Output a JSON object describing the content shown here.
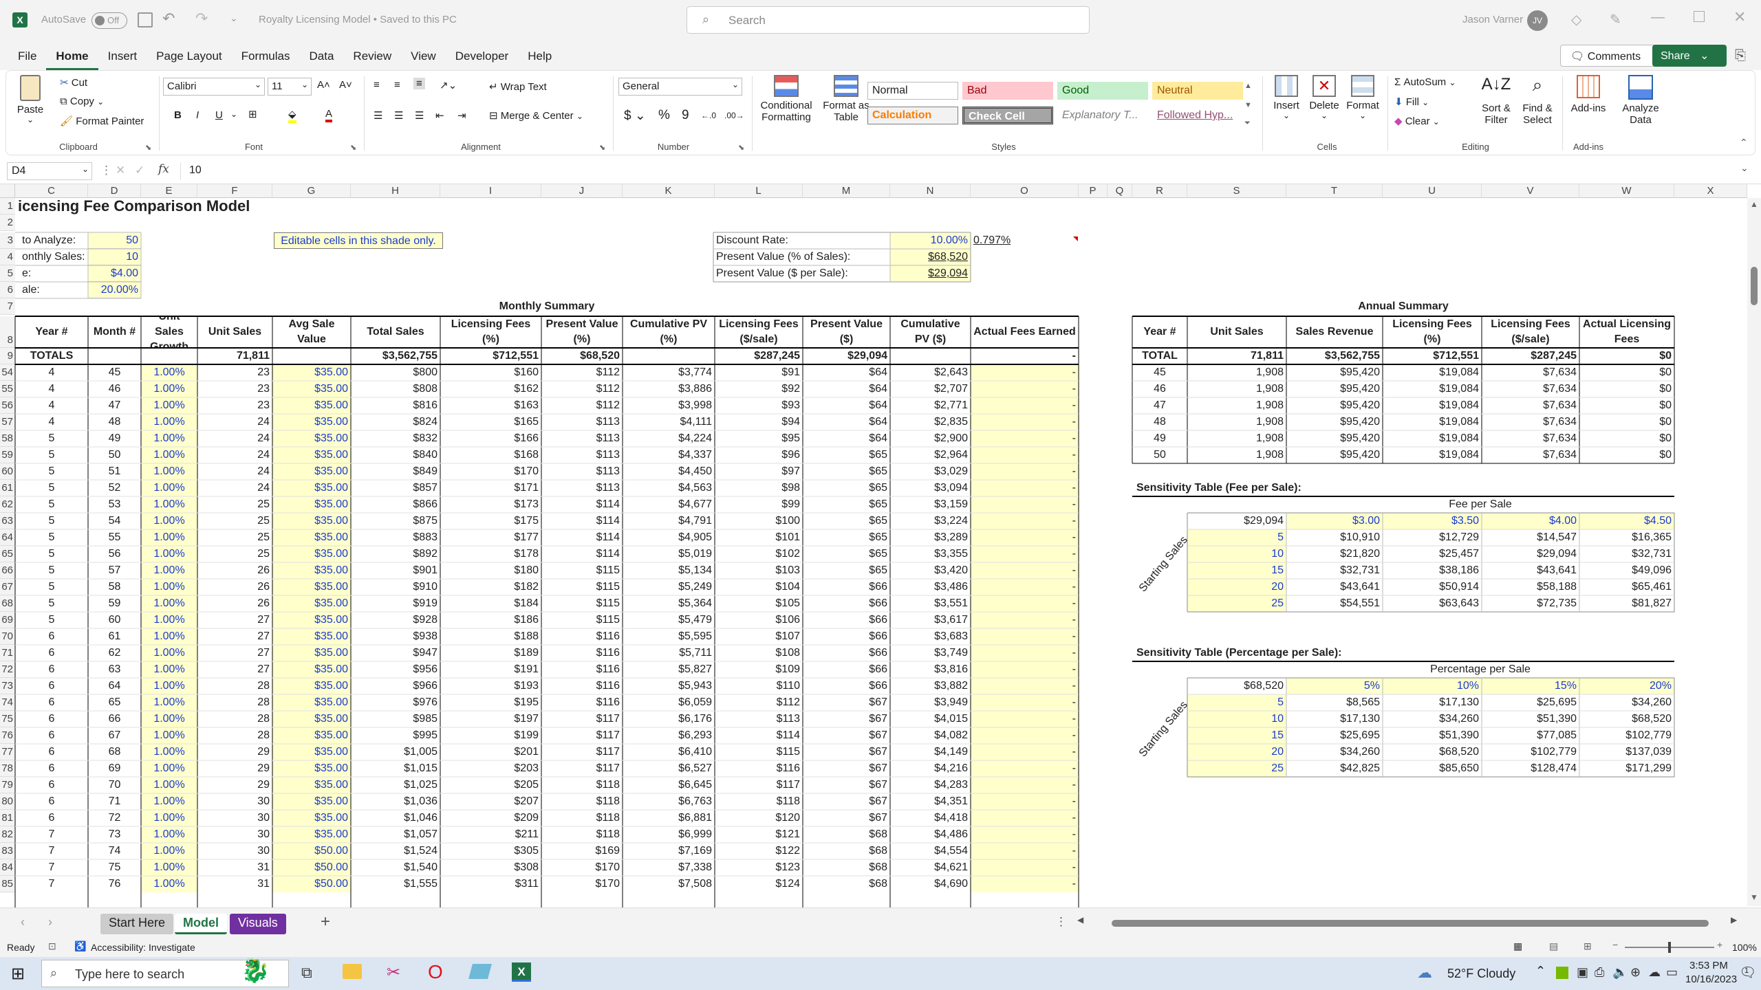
{
  "titlebar": {
    "autosave_label": "AutoSave",
    "autosave_state": "Off",
    "doc_title": "Royalty Licensing Model • Saved to this PC",
    "search_placeholder": "Search",
    "user_name": "Jason Varner",
    "user_initials": "JV"
  },
  "menu": [
    "File",
    "Home",
    "Insert",
    "Page Layout",
    "Formulas",
    "Data",
    "Review",
    "View",
    "Developer",
    "Help"
  ],
  "menu_active": "Home",
  "comments_label": "Comments",
  "share_label": "Share",
  "ribbon": {
    "clipboard": {
      "paste": "Paste",
      "cut": "Cut",
      "copy": "Copy",
      "format_painter": "Format Painter",
      "label": "Clipboard"
    },
    "font": {
      "name": "Calibri",
      "size": "11",
      "label": "Font"
    },
    "alignment": {
      "wrap": "Wrap Text",
      "merge": "Merge & Center",
      "label": "Alignment"
    },
    "number": {
      "format": "General",
      "label": "Number"
    },
    "styles": {
      "cond_fmt": "Conditional Formatting",
      "fmt_table": "Format as Table",
      "label": "Styles",
      "items": [
        "Normal",
        "Bad",
        "Good",
        "Neutral",
        "Calculation",
        "Check Cell",
        "Explanatory T...",
        "Followed Hyp..."
      ]
    },
    "cells": {
      "insert": "Insert",
      "delete": "Delete",
      "format": "Format",
      "label": "Cells"
    },
    "editing": {
      "autosum": "AutoSum",
      "fill": "Fill",
      "clear": "Clear",
      "sort": "Sort & Filter",
      "find": "Find & Select",
      "label": "Editing"
    },
    "addins": {
      "addins": "Add-ins",
      "analyze": "Analyze Data",
      "label": "Add-ins"
    }
  },
  "formula": {
    "namebox": "D4",
    "value": "10"
  },
  "columns": [
    "C",
    "D",
    "E",
    "F",
    "G",
    "H",
    "I",
    "J",
    "K",
    "L",
    "M",
    "N",
    "O",
    "P",
    "Q",
    "R",
    "S",
    "T",
    "U",
    "V",
    "W",
    "X"
  ],
  "rows_top": [
    "1",
    "2",
    "3",
    "4",
    "5",
    "6",
    "7",
    "8",
    "9"
  ],
  "sheet": {
    "title": "icensing Fee Comparison Model",
    "inputs": [
      {
        "label": " to Analyze:",
        "value": "50"
      },
      {
        "label": "onthly Sales:",
        "value": "10"
      },
      {
        "label": "e:",
        "value": "$4.00"
      },
      {
        "label": "ale:",
        "value": "20.00%"
      }
    ],
    "editable_note": "Editable cells in this shade only.",
    "discount": {
      "rows": [
        {
          "label": "Discount Rate:",
          "value": "10.00%",
          "extra": "0.797%"
        },
        {
          "label": "Present Value (% of Sales):",
          "value": "$68,520",
          "extra": ""
        },
        {
          "label": "Present Value ($ per Sale):",
          "value": "$29,094",
          "extra": ""
        }
      ]
    },
    "monthly_title": "Monthly Summary",
    "monthly_headers": [
      "Year #",
      "Month #",
      "Unit Sales Growth",
      "Unit Sales",
      "Avg Sale Value",
      "Total Sales",
      "Licensing Fees (%)",
      "Present Value (%)",
      "Cumulative PV (%)",
      "Licensing Fees ($/sale)",
      "Present Value ($)",
      "Cumulative PV ($)",
      "Actual Fees Earned"
    ],
    "monthly_totals": [
      "TOTALS",
      "",
      "",
      "71,811",
      "",
      "$3,562,755",
      "$712,551",
      "$68,520",
      "",
      "$287,245",
      "$29,094",
      "",
      "-"
    ],
    "monthly_rows": [
      [
        "54",
        "4",
        "45",
        "1.00%",
        "23",
        "$35.00",
        "$800",
        "$160",
        "$112",
        "$3,774",
        "$91",
        "$64",
        "$2,643",
        "-"
      ],
      [
        "55",
        "4",
        "46",
        "1.00%",
        "23",
        "$35.00",
        "$808",
        "$162",
        "$112",
        "$3,886",
        "$92",
        "$64",
        "$2,707",
        "-"
      ],
      [
        "56",
        "4",
        "47",
        "1.00%",
        "23",
        "$35.00",
        "$816",
        "$163",
        "$112",
        "$3,998",
        "$93",
        "$64",
        "$2,771",
        "-"
      ],
      [
        "57",
        "4",
        "48",
        "1.00%",
        "24",
        "$35.00",
        "$824",
        "$165",
        "$113",
        "$4,111",
        "$94",
        "$64",
        "$2,835",
        "-"
      ],
      [
        "58",
        "5",
        "49",
        "1.00%",
        "24",
        "$35.00",
        "$832",
        "$166",
        "$113",
        "$4,224",
        "$95",
        "$64",
        "$2,900",
        "-"
      ],
      [
        "59",
        "5",
        "50",
        "1.00%",
        "24",
        "$35.00",
        "$840",
        "$168",
        "$113",
        "$4,337",
        "$96",
        "$65",
        "$2,964",
        "-"
      ],
      [
        "60",
        "5",
        "51",
        "1.00%",
        "24",
        "$35.00",
        "$849",
        "$170",
        "$113",
        "$4,450",
        "$97",
        "$65",
        "$3,029",
        "-"
      ],
      [
        "61",
        "5",
        "52",
        "1.00%",
        "24",
        "$35.00",
        "$857",
        "$171",
        "$113",
        "$4,563",
        "$98",
        "$65",
        "$3,094",
        "-"
      ],
      [
        "62",
        "5",
        "53",
        "1.00%",
        "25",
        "$35.00",
        "$866",
        "$173",
        "$114",
        "$4,677",
        "$99",
        "$65",
        "$3,159",
        "-"
      ],
      [
        "63",
        "5",
        "54",
        "1.00%",
        "25",
        "$35.00",
        "$875",
        "$175",
        "$114",
        "$4,791",
        "$100",
        "$65",
        "$3,224",
        "-"
      ],
      [
        "64",
        "5",
        "55",
        "1.00%",
        "25",
        "$35.00",
        "$883",
        "$177",
        "$114",
        "$4,905",
        "$101",
        "$65",
        "$3,289",
        "-"
      ],
      [
        "65",
        "5",
        "56",
        "1.00%",
        "25",
        "$35.00",
        "$892",
        "$178",
        "$114",
        "$5,019",
        "$102",
        "$65",
        "$3,355",
        "-"
      ],
      [
        "66",
        "5",
        "57",
        "1.00%",
        "26",
        "$35.00",
        "$901",
        "$180",
        "$115",
        "$5,134",
        "$103",
        "$65",
        "$3,420",
        "-"
      ],
      [
        "67",
        "5",
        "58",
        "1.00%",
        "26",
        "$35.00",
        "$910",
        "$182",
        "$115",
        "$5,249",
        "$104",
        "$66",
        "$3,486",
        "-"
      ],
      [
        "68",
        "5",
        "59",
        "1.00%",
        "26",
        "$35.00",
        "$919",
        "$184",
        "$115",
        "$5,364",
        "$105",
        "$66",
        "$3,551",
        "-"
      ],
      [
        "69",
        "5",
        "60",
        "1.00%",
        "27",
        "$35.00",
        "$928",
        "$186",
        "$115",
        "$5,479",
        "$106",
        "$66",
        "$3,617",
        "-"
      ],
      [
        "70",
        "6",
        "61",
        "1.00%",
        "27",
        "$35.00",
        "$938",
        "$188",
        "$116",
        "$5,595",
        "$107",
        "$66",
        "$3,683",
        "-"
      ],
      [
        "71",
        "6",
        "62",
        "1.00%",
        "27",
        "$35.00",
        "$947",
        "$189",
        "$116",
        "$5,711",
        "$108",
        "$66",
        "$3,749",
        "-"
      ],
      [
        "72",
        "6",
        "63",
        "1.00%",
        "27",
        "$35.00",
        "$956",
        "$191",
        "$116",
        "$5,827",
        "$109",
        "$66",
        "$3,816",
        "-"
      ],
      [
        "73",
        "6",
        "64",
        "1.00%",
        "28",
        "$35.00",
        "$966",
        "$193",
        "$116",
        "$5,943",
        "$110",
        "$66",
        "$3,882",
        "-"
      ],
      [
        "74",
        "6",
        "65",
        "1.00%",
        "28",
        "$35.00",
        "$976",
        "$195",
        "$116",
        "$6,059",
        "$112",
        "$67",
        "$3,949",
        "-"
      ],
      [
        "75",
        "6",
        "66",
        "1.00%",
        "28",
        "$35.00",
        "$985",
        "$197",
        "$117",
        "$6,176",
        "$113",
        "$67",
        "$4,015",
        "-"
      ],
      [
        "76",
        "6",
        "67",
        "1.00%",
        "28",
        "$35.00",
        "$995",
        "$199",
        "$117",
        "$6,293",
        "$114",
        "$67",
        "$4,082",
        "-"
      ],
      [
        "77",
        "6",
        "68",
        "1.00%",
        "29",
        "$35.00",
        "$1,005",
        "$201",
        "$117",
        "$6,410",
        "$115",
        "$67",
        "$4,149",
        "-"
      ],
      [
        "78",
        "6",
        "69",
        "1.00%",
        "29",
        "$35.00",
        "$1,015",
        "$203",
        "$117",
        "$6,527",
        "$116",
        "$67",
        "$4,216",
        "-"
      ],
      [
        "79",
        "6",
        "70",
        "1.00%",
        "29",
        "$35.00",
        "$1,025",
        "$205",
        "$118",
        "$6,645",
        "$117",
        "$67",
        "$4,283",
        "-"
      ],
      [
        "80",
        "6",
        "71",
        "1.00%",
        "30",
        "$35.00",
        "$1,036",
        "$207",
        "$118",
        "$6,763",
        "$118",
        "$67",
        "$4,351",
        "-"
      ],
      [
        "81",
        "6",
        "72",
        "1.00%",
        "30",
        "$35.00",
        "$1,046",
        "$209",
        "$118",
        "$6,881",
        "$120",
        "$67",
        "$4,418",
        "-"
      ],
      [
        "82",
        "7",
        "73",
        "1.00%",
        "30",
        "$35.00",
        "$1,057",
        "$211",
        "$118",
        "$6,999",
        "$121",
        "$68",
        "$4,486",
        "-"
      ],
      [
        "83",
        "7",
        "74",
        "1.00%",
        "30",
        "$50.00",
        "$1,524",
        "$305",
        "$169",
        "$7,169",
        "$122",
        "$68",
        "$4,554",
        "-"
      ],
      [
        "84",
        "7",
        "75",
        "1.00%",
        "31",
        "$50.00",
        "$1,540",
        "$308",
        "$170",
        "$7,338",
        "$123",
        "$68",
        "$4,621",
        "-"
      ],
      [
        "85",
        "7",
        "76",
        "1.00%",
        "31",
        "$50.00",
        "$1,555",
        "$311",
        "$170",
        "$7,508",
        "$124",
        "$68",
        "$4,690",
        "-"
      ]
    ],
    "annual_title": "Annual Summary",
    "annual_headers": [
      "Year #",
      "Unit Sales",
      "Sales Revenue",
      "Licensing Fees (%)",
      "Licensing Fees ($/sale)",
      "Actual Licensing Fees"
    ],
    "annual_totals": [
      "TOTAL",
      "71,811",
      "$3,562,755",
      "$712,551",
      "$287,245",
      "$0"
    ],
    "annual_rows": [
      [
        "45",
        "1,908",
        "$95,420",
        "$19,084",
        "$7,634",
        "$0"
      ],
      [
        "46",
        "1,908",
        "$95,420",
        "$19,084",
        "$7,634",
        "$0"
      ],
      [
        "47",
        "1,908",
        "$95,420",
        "$19,084",
        "$7,634",
        "$0"
      ],
      [
        "48",
        "1,908",
        "$95,420",
        "$19,084",
        "$7,634",
        "$0"
      ],
      [
        "49",
        "1,908",
        "$95,420",
        "$19,084",
        "$7,634",
        "$0"
      ],
      [
        "50",
        "1,908",
        "$95,420",
        "$19,084",
        "$7,634",
        "$0"
      ]
    ],
    "sens_fee": {
      "title": "Sensitivity Table (Fee per Sale):",
      "subtitle": "Fee per Sale",
      "corner": "$29,094",
      "cols": [
        "$3.00",
        "$3.50",
        "$4.00",
        "$4.50"
      ],
      "side_label": "Starting Sales",
      "rows": [
        [
          "5",
          "$10,910",
          "$12,729",
          "$14,547",
          "$16,365"
        ],
        [
          "10",
          "$21,820",
          "$25,457",
          "$29,094",
          "$32,731"
        ],
        [
          "15",
          "$32,731",
          "$38,186",
          "$43,641",
          "$49,096"
        ],
        [
          "20",
          "$43,641",
          "$50,914",
          "$58,188",
          "$65,461"
        ],
        [
          "25",
          "$54,551",
          "$63,643",
          "$72,735",
          "$81,827"
        ]
      ]
    },
    "sens_pct": {
      "title": "Sensitivity Table (Percentage per Sale):",
      "subtitle": "Percentage per Sale",
      "corner": "$68,520",
      "cols": [
        "5%",
        "10%",
        "15%",
        "20%"
      ],
      "side_label": "Starting Sales",
      "rows": [
        [
          "5",
          "$8,565",
          "$17,130",
          "$25,695",
          "$34,260"
        ],
        [
          "10",
          "$17,130",
          "$34,260",
          "$51,390",
          "$68,520"
        ],
        [
          "15",
          "$25,695",
          "$51,390",
          "$77,085",
          "$102,779"
        ],
        [
          "20",
          "$34,260",
          "$68,520",
          "$102,779",
          "$137,039"
        ],
        [
          "25",
          "$42,825",
          "$85,650",
          "$128,474",
          "$171,299"
        ]
      ]
    }
  },
  "tabs": [
    {
      "label": "Start Here",
      "style": "gray"
    },
    {
      "label": "Model",
      "style": "active"
    },
    {
      "label": "Visuals",
      "style": "purple"
    }
  ],
  "status": {
    "ready": "Ready",
    "accessibility": "Accessibility: Investigate",
    "zoom": "100%"
  },
  "taskbar": {
    "search_placeholder": "Type here to search",
    "weather": "52°F  Cloudy",
    "time": "3:53 PM",
    "date": "10/16/2023",
    "notif": "1"
  },
  "colors": {
    "excel_green": "#217346",
    "input_yellow": "#ffffcc",
    "input_blue": "#1a3bd0",
    "visuals_tab": "#7030a0"
  }
}
